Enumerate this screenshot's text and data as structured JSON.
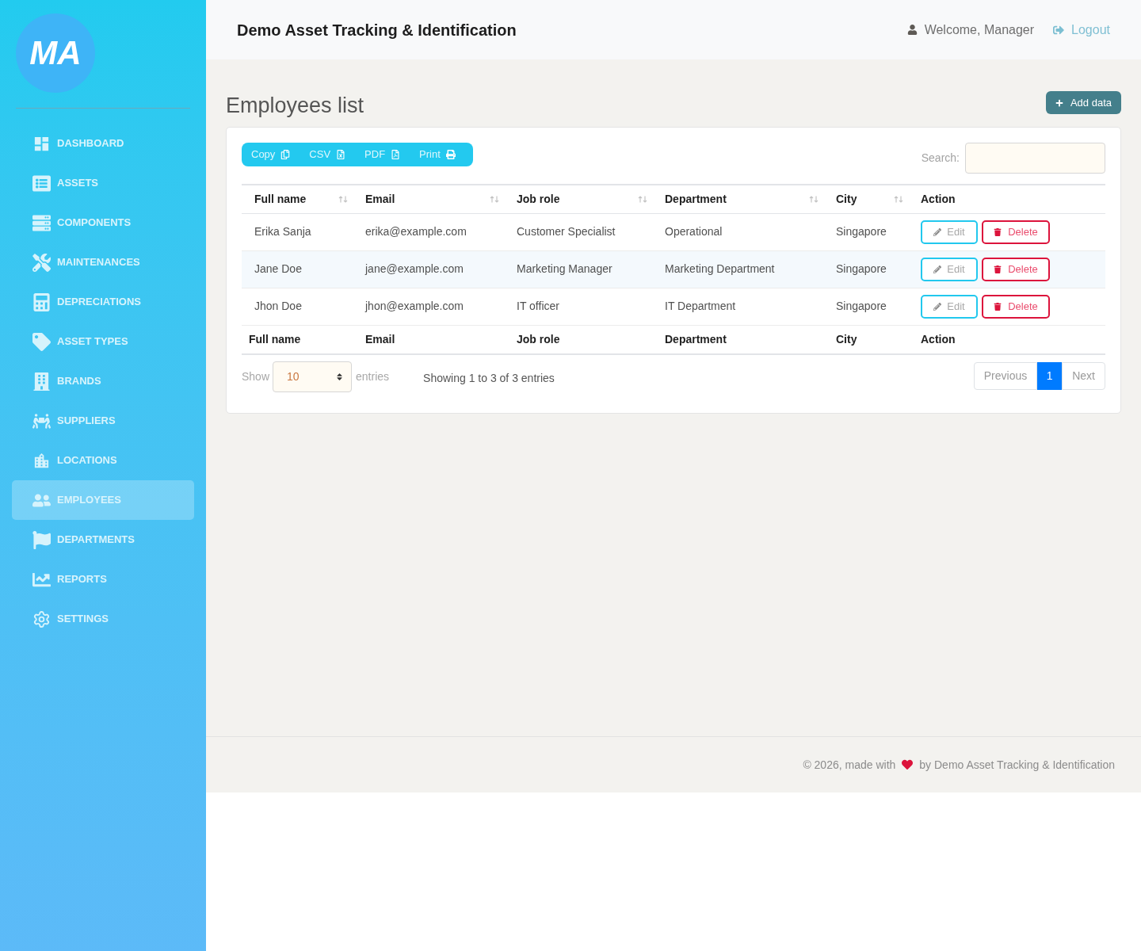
{
  "sidebar": {
    "logo": "MA",
    "items": [
      {
        "label": "DASHBOARD",
        "selected": false
      },
      {
        "label": "ASSETS",
        "selected": false
      },
      {
        "label": "COMPONENTS",
        "selected": false
      },
      {
        "label": "MAINTENANCES",
        "selected": false
      },
      {
        "label": "DEPRECIATIONS",
        "selected": false
      },
      {
        "label": "ASSET TYPES",
        "selected": false
      },
      {
        "label": "BRANDS",
        "selected": false
      },
      {
        "label": "SUPPLIERS",
        "selected": false
      },
      {
        "label": "LOCATIONS",
        "selected": false
      },
      {
        "label": "EMPLOYEES",
        "selected": true
      },
      {
        "label": "DEPARTMENTS",
        "selected": false
      },
      {
        "label": "REPORTS",
        "selected": false
      },
      {
        "label": "SETTINGS",
        "selected": false
      }
    ]
  },
  "header": {
    "title": "Demo Asset Tracking & Identification",
    "welcome": "Welcome, Manager",
    "logout": "Logout"
  },
  "page": {
    "title": "Employees list",
    "add_button": "Add data"
  },
  "toolbar": {
    "export_buttons": [
      "Copy",
      "CSV",
      "PDF",
      "Print"
    ],
    "search": {
      "label": "Search:"
    }
  },
  "table": {
    "columns": [
      {
        "label": "Full name",
        "sortable": true
      },
      {
        "label": "Email",
        "sortable": true
      },
      {
        "label": "Job role",
        "sortable": true
      },
      {
        "label": "Department",
        "sortable": true
      },
      {
        "label": "City",
        "sortable": true
      },
      {
        "label": "Action",
        "sortable": false
      }
    ],
    "rows": [
      {
        "cells": [
          "Erika Sanja",
          "erika@example.com",
          "Customer Specialist",
          "Operational",
          "Singapore"
        ],
        "actions": [
          "Edit",
          "Delete"
        ]
      },
      {
        "cells": [
          "Jane Doe",
          "jane@example.com",
          "Marketing Manager",
          "Marketing Department",
          "Singapore"
        ],
        "actions": [
          "Edit",
          "Delete"
        ]
      },
      {
        "cells": [
          "Jhon Doe",
          "jhon@example.com",
          "IT officer",
          "IT Department",
          "Singapore"
        ],
        "actions": [
          "Edit",
          "Delete"
        ]
      }
    ],
    "footer": [
      "Full name",
      "Email",
      "Job role",
      "Department",
      "City",
      "Action"
    ]
  },
  "length": {
    "show": "Show",
    "value": "10",
    "entries": "entries"
  },
  "info": "Showing 1 to 3 of 3 entries",
  "pagination": {
    "previous": "Previous",
    "pages": [
      {
        "label": "1",
        "selected": true
      }
    ],
    "next": "Next"
  },
  "footer": {
    "before": "© 2026, made with",
    "after": "by Demo Asset Tracking & Identification"
  }
}
